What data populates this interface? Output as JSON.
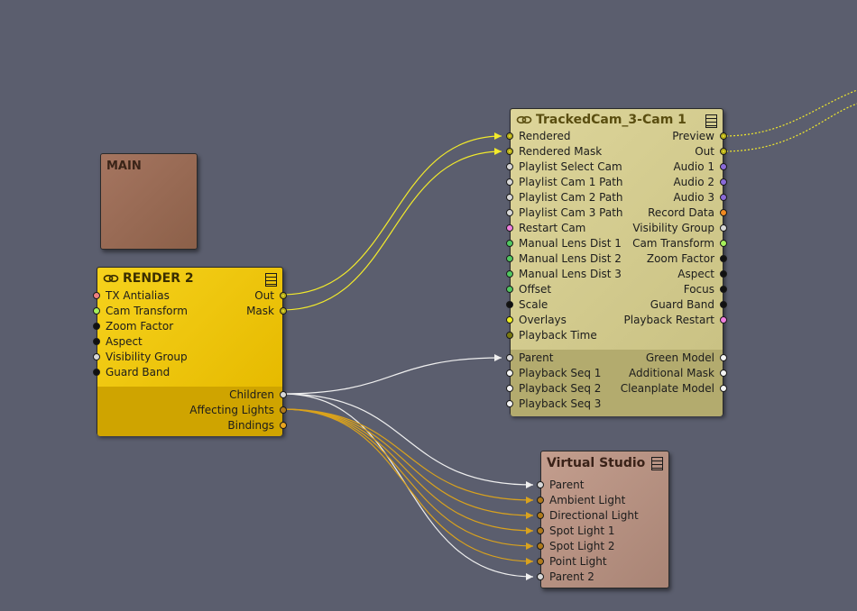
{
  "colors": {
    "canvas_bg": "#5b5e6e",
    "wire_yellow": "#f2ea2b",
    "wire_white": "#f0f0f0",
    "wire_gold": "#d9a21d",
    "main_node": "#9a6a52",
    "render_node": "#f1c400",
    "tracked_node": "#d1c98a",
    "virtual_node": "#b48e7e"
  },
  "nodes": {
    "main": {
      "title": "MAIN"
    },
    "render2": {
      "title": "RENDER 2",
      "inputs": [
        {
          "label": "TX Antialias",
          "color": "#f08080"
        },
        {
          "label": "Cam Transform",
          "color": "#a6f05a"
        },
        {
          "label": "Zoom Factor",
          "color": "#111111"
        },
        {
          "label": "Aspect",
          "color": "#111111"
        },
        {
          "label": "Visibility Group",
          "color": "#d8d8d8"
        },
        {
          "label": "Guard Band",
          "color": "#111111"
        }
      ],
      "outputs": [
        {
          "label": "Out",
          "color": "#e8de3a"
        },
        {
          "label": "Mask",
          "color": "#e8de3a"
        }
      ],
      "children_outputs": [
        {
          "label": "Children",
          "color": "#d8d8d8"
        },
        {
          "label": "Affecting Lights",
          "color": "#b07a1a"
        },
        {
          "label": "Bindings",
          "color": "#e9a520"
        }
      ]
    },
    "tracked": {
      "title": "TrackedCam_3-Cam 1",
      "inputs": [
        {
          "label": "Rendered",
          "color": "#e8de3a"
        },
        {
          "label": "Rendered Mask",
          "color": "#e8de3a"
        },
        {
          "label": "Playlist Select Cam",
          "color": "#d8d8d8"
        },
        {
          "label": "Playlist Cam 1 Path",
          "color": "#d8d8d8"
        },
        {
          "label": "Playlist Cam 2 Path",
          "color": "#d8d8d8"
        },
        {
          "label": "Playlist Cam 3 Path",
          "color": "#d8d8d8"
        },
        {
          "label": "Restart Cam",
          "color": "#f080e0"
        },
        {
          "label": "Manual Lens Dist 1",
          "color": "#50c860"
        },
        {
          "label": "Manual Lens Dist 2",
          "color": "#50c860"
        },
        {
          "label": "Manual Lens Dist 3",
          "color": "#50c860"
        },
        {
          "label": "Offset",
          "color": "#50c860"
        },
        {
          "label": "Scale",
          "color": "#111111"
        },
        {
          "label": "Overlays",
          "color": "#f0f020"
        },
        {
          "label": "Playback Time",
          "color": "#7a7a10"
        }
      ],
      "outputs": [
        {
          "label": "Preview",
          "color": "#e8de3a"
        },
        {
          "label": "Out",
          "color": "#e8de3a"
        },
        {
          "label": "Audio 1",
          "color": "#8a6ad8"
        },
        {
          "label": "Audio 2",
          "color": "#8a6ad8"
        },
        {
          "label": "Audio 3",
          "color": "#8a6ad8"
        },
        {
          "label": "Record Data",
          "color": "#f08a20"
        },
        {
          "label": "Visibility Group",
          "color": "#d8d8d8"
        },
        {
          "label": "Cam Transform",
          "color": "#a6f05a"
        },
        {
          "label": "Zoom Factor",
          "color": "#111111"
        },
        {
          "label": "Aspect",
          "color": "#111111"
        },
        {
          "label": "Focus",
          "color": "#111111"
        },
        {
          "label": "Guard Band",
          "color": "#111111"
        },
        {
          "label": "Playback Restart",
          "color": "#f080e0"
        }
      ],
      "lower_inputs": [
        {
          "label": "Parent",
          "color": "#d8d8d8"
        },
        {
          "label": "Playback Seq 1",
          "color": "#f4f4f4"
        },
        {
          "label": "Playback Seq 2",
          "color": "#f4f4f4"
        },
        {
          "label": "Playback Seq 3",
          "color": "#f4f4f4"
        }
      ],
      "lower_outputs": [
        {
          "label": "Green Model",
          "color": "#f4f4f4"
        },
        {
          "label": "Additional Mask",
          "color": "#f4f4f4"
        },
        {
          "label": "Cleanplate Model",
          "color": "#f4f4f4"
        }
      ]
    },
    "virtual": {
      "title": "Virtual Studio",
      "inputs": [
        {
          "label": "Parent",
          "color": "#d8d8d8"
        },
        {
          "label": "Ambient Light",
          "color": "#b07a1a"
        },
        {
          "label": "Directional Light",
          "color": "#b07a1a"
        },
        {
          "label": "Spot Light 1",
          "color": "#b07a1a"
        },
        {
          "label": "Spot Light 2",
          "color": "#b07a1a"
        },
        {
          "label": "Point Light",
          "color": "#b07a1a"
        },
        {
          "label": "Parent 2",
          "color": "#d8d8d8"
        }
      ]
    }
  }
}
